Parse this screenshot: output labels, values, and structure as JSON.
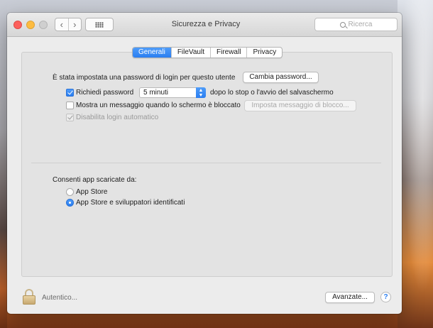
{
  "window": {
    "title": "Sicurezza e Privacy",
    "search_placeholder": "Ricerca"
  },
  "nav": {
    "back_icon": "chevron-left-icon",
    "forward_icon": "chevron-right-icon",
    "back_glyph": "‹",
    "forward_glyph": "›"
  },
  "tabs": [
    {
      "label": "Generali",
      "active": true
    },
    {
      "label": "FileVault",
      "active": false
    },
    {
      "label": "Firewall",
      "active": false
    },
    {
      "label": "Privacy",
      "active": false
    }
  ],
  "general": {
    "password_set_text": "È stata impostata una password di login per questo utente",
    "change_password_button": "Cambia password...",
    "require_password": {
      "label": "Richiedi password",
      "checked": true
    },
    "require_password_delay": {
      "selected": "5 minuti"
    },
    "require_password_suffix": "dopo lo stop o l'avvio del salvaschermo",
    "show_message": {
      "label": "Mostra un messaggio quando lo schermo è bloccato",
      "checked": false
    },
    "set_lock_message_button": "Imposta messaggio di blocco...",
    "disable_auto_login": {
      "label": "Disabilita login automatico",
      "checked": true,
      "enabled": false
    }
  },
  "downloads": {
    "heading": "Consenti app scaricate da:",
    "options": [
      {
        "label": "App Store",
        "selected": false
      },
      {
        "label": "App Store e sviluppatori identificati",
        "selected": true
      }
    ]
  },
  "footer": {
    "lock_label": "Autentico...",
    "advanced_button": "Avanzate...",
    "help_glyph": "?"
  },
  "colors": {
    "accent": "#2a7ef1"
  }
}
